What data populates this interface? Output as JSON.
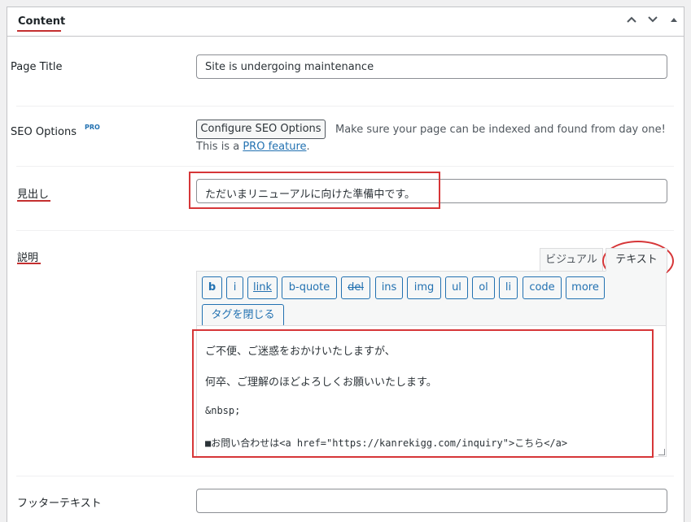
{
  "panel": {
    "title": "Content",
    "controls": [
      "chevron-up",
      "chevron-down",
      "triangle-up"
    ]
  },
  "page_title": {
    "label": "Page Title",
    "value": "Site is undergoing maintenance"
  },
  "seo": {
    "label": "SEO Options",
    "pro_badge": "PRO",
    "button_label": "Configure SEO Options",
    "help_text": "Make sure your page can be indexed and found from day one!",
    "note_prefix": "This is a ",
    "note_link": "PRO feature",
    "note_suffix": "."
  },
  "heading": {
    "label": "見出し",
    "value": "ただいまリニューアルに向けた準備中です。"
  },
  "description": {
    "label": "説明",
    "tabs": {
      "visual": "ビジュアル",
      "text": "テキスト"
    },
    "active_tab": "text",
    "toolbar": [
      "b",
      "i",
      "link",
      "b-quote",
      "del",
      "ins",
      "img",
      "ul",
      "ol",
      "li",
      "code",
      "more",
      "タグを閉じる"
    ],
    "content_lines": [
      "ご不便、ご迷惑をおかけいたしますが、",
      "何卒、ご理解のほどよろしくお願いいたします。",
      "&nbsp;",
      "■お問い合わせは<a href=\"https://kanrekigg.com/inquiry\">こちら</a>"
    ]
  },
  "footer_text": {
    "label": "フッターテキスト",
    "value": ""
  },
  "colors": {
    "accent": "#2271b1",
    "annotation_red": "#d63638",
    "border": "#c3c4c7"
  }
}
